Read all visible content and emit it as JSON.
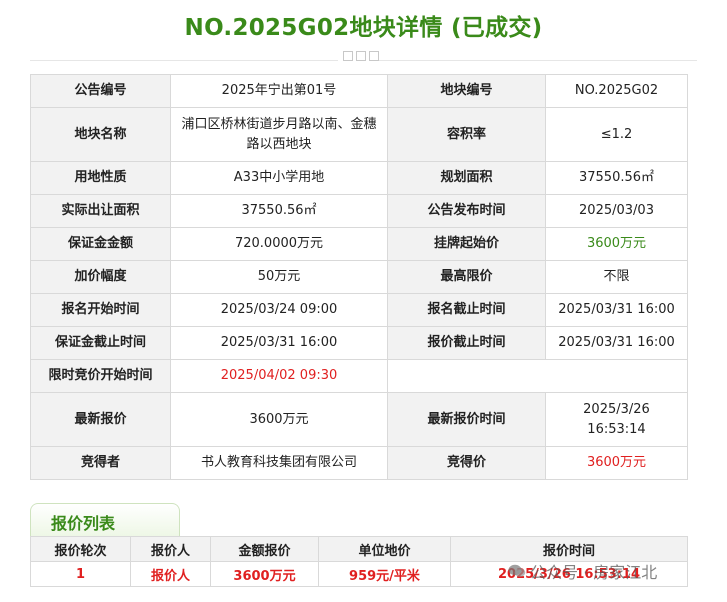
{
  "page": {
    "title": "NO.2025G02地块详情 (已成交)"
  },
  "detail_rows": [
    [
      {
        "label": "公告编号",
        "value": "2025年宁出第01号"
      },
      {
        "label": "地块编号",
        "value": "NO.2025G02"
      }
    ],
    [
      {
        "label": "地块名称",
        "value": "浦口区桥林街道步月路以南、金穗路以西地块"
      },
      {
        "label": "容积率",
        "value": "≤1.2"
      }
    ],
    [
      {
        "label": "用地性质",
        "value": "A33中小学用地"
      },
      {
        "label": "规划面积",
        "value": "37550.56㎡"
      }
    ],
    [
      {
        "label": "实际出让面积",
        "value": "37550.56㎡"
      },
      {
        "label": "公告发布时间",
        "value": "2025/03/03"
      }
    ],
    [
      {
        "label": "保证金金额",
        "value": "720.0000万元"
      },
      {
        "label": "挂牌起始价",
        "value": "3600万元"
      }
    ],
    [
      {
        "label": "加价幅度",
        "value": "50万元"
      },
      {
        "label": "最高限价",
        "value": "不限"
      }
    ],
    [
      {
        "label": "报名开始时间",
        "value": "2025/03/24 09:00"
      },
      {
        "label": "报名截止时间",
        "value": "2025/03/31 16:00"
      }
    ],
    [
      {
        "label": "保证金截止时间",
        "value": "2025/03/31 16:00"
      },
      {
        "label": "报价截止时间",
        "value": "2025/03/31 16:00"
      }
    ],
    [
      {
        "label": "限时竞价开始时间",
        "value": "2025/04/02 09:30"
      }
    ],
    [
      {
        "label": "最新报价",
        "value": "3600万元"
      },
      {
        "label": "最新报价时间",
        "value": "2025/3/26 16:53:14"
      }
    ],
    [
      {
        "label": "竞得者",
        "value": "书人教育科技集团有限公司"
      },
      {
        "label": "竞得价",
        "value": "3600万元"
      }
    ]
  ],
  "bid_list": {
    "tab_label": "报价列表",
    "headers": [
      "报价轮次",
      "报价人",
      "金额报价",
      "单位地价",
      "报价时间"
    ],
    "rows": [
      [
        "1",
        "报价人",
        "3600万元",
        "959元/平米",
        "2025/3/26 16:53:14"
      ]
    ]
  },
  "watermark": {
    "text": "公众号 · 房家江北",
    "icon": "wechat-icon"
  },
  "colors": {
    "title": "#3a8a1a",
    "highlight_red": "#e02020",
    "highlight_green": "#3a8a1a",
    "label_bg": "#f2f2f2"
  }
}
